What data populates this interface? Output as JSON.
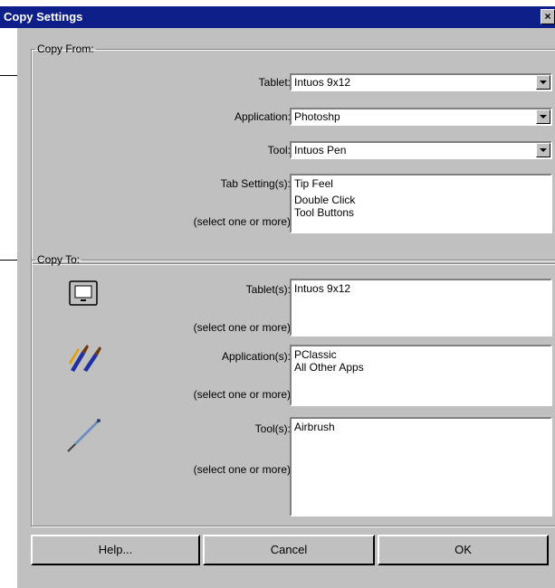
{
  "window": {
    "title": "Copy Settings",
    "close_glyph": "×"
  },
  "copy_from": {
    "legend": "Copy From:",
    "tablet_label": "Tablet:",
    "tablet_value": "Intuos 9x12",
    "application_label": "Application:",
    "application_value": "Photoshp",
    "tool_label": "Tool:",
    "tool_value": "Intuos Pen",
    "tab_settings_label": "Tab Setting(s):",
    "tab_settings_hint": "(select one or more)",
    "tab_settings_items": [
      "Tip Feel",
      "Double Click",
      "Tool Buttons"
    ]
  },
  "copy_to": {
    "legend": "Copy To:",
    "tablets_label": "Tablet(s):",
    "tablets_hint": "(select one or more)",
    "tablets_items": [
      "Intuos 9x12"
    ],
    "applications_label": "Application(s):",
    "applications_hint": "(select one or more)",
    "applications_items": [
      "PClassic",
      "All Other Apps"
    ],
    "tools_label": "Tool(s):",
    "tools_hint": "(select one or more)",
    "tools_items": [
      "Airbrush"
    ],
    "icons": [
      "tablet-icon",
      "brushes-icon",
      "pen-icon"
    ]
  },
  "buttons": {
    "help": "Help...",
    "cancel": "Cancel",
    "ok": "OK"
  }
}
